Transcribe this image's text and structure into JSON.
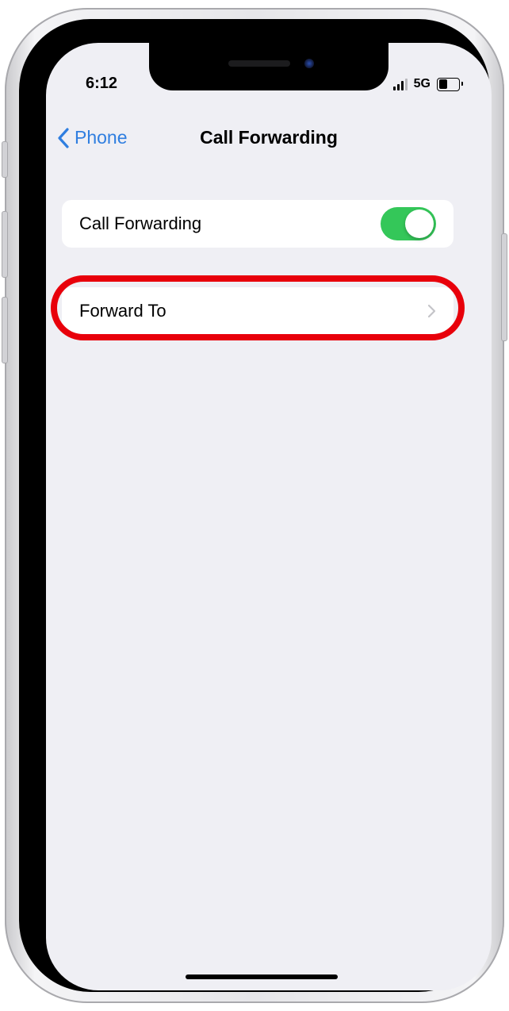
{
  "status_bar": {
    "time": "6:12",
    "network": "5G",
    "signal_bars_active": 3,
    "signal_bars_total": 4,
    "battery_level": 0.45
  },
  "nav": {
    "back_icon": "chevron-left-icon",
    "back_label": "Phone",
    "title": "Call Forwarding"
  },
  "settings": {
    "call_forwarding": {
      "label": "Call Forwarding",
      "toggle_on": true
    },
    "forward_to": {
      "label": "Forward To",
      "icon": "chevron-right-icon"
    }
  },
  "colors": {
    "accent_blue": "#2f7ee0",
    "toggle_green": "#34c759",
    "highlight_red": "#e8000b",
    "background": "#efeff4",
    "chevron_gray": "#c4c4c8"
  }
}
